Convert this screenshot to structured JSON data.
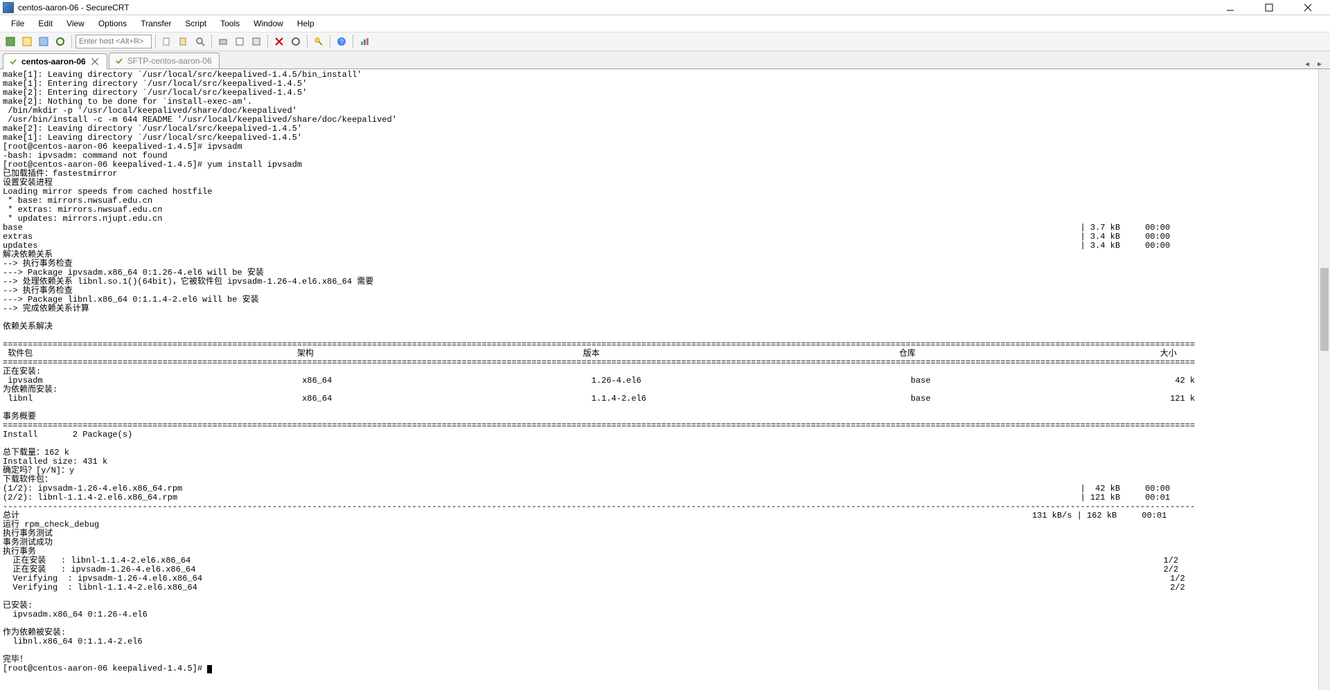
{
  "window": {
    "title": "centos-aaron-06 - SecureCRT"
  },
  "menu": [
    "File",
    "Edit",
    "View",
    "Options",
    "Transfer",
    "Script",
    "Tools",
    "Window",
    "Help"
  ],
  "toolbar": {
    "host_placeholder": "Enter host <Alt+R>"
  },
  "tabs": [
    {
      "label": "centos-aaron-06",
      "active": true,
      "closable": true
    },
    {
      "label": "SFTP-centos-aaron-06",
      "active": false,
      "closable": false
    }
  ],
  "terminal_lines": [
    "make[1]: Leaving directory `/usr/local/src/keepalived-1.4.5/bin_install'",
    "make[1]: Entering directory `/usr/local/src/keepalived-1.4.5'",
    "make[2]: Entering directory `/usr/local/src/keepalived-1.4.5'",
    "make[2]: Nothing to be done for `install-exec-am'.",
    " /bin/mkdir -p '/usr/local/keepalived/share/doc/keepalived'",
    " /usr/bin/install -c -m 644 README '/usr/local/keepalived/share/doc/keepalived'",
    "make[2]: Leaving directory `/usr/local/src/keepalived-1.4.5'",
    "make[1]: Leaving directory `/usr/local/src/keepalived-1.4.5'",
    "[root@centos-aaron-06 keepalived-1.4.5]# ipvsadm",
    "-bash: ipvsadm: command not found",
    "[root@centos-aaron-06 keepalived-1.4.5]# yum install ipvsadm",
    "已加载插件：fastestmirror",
    "设置安装进程",
    "Loading mirror speeds from cached hostfile",
    " * base: mirrors.nwsuaf.edu.cn",
    " * extras: mirrors.nwsuaf.edu.cn",
    " * updates: mirrors.njupt.edu.cn",
    "base                                                                                                                                                                                                                    | 3.7 kB     00:00",
    "extras                                                                                                                                                                                                                  | 3.4 kB     00:00",
    "updates                                                                                                                                                                                                                 | 3.4 kB     00:00",
    "解决依赖关系",
    "--> 执行事务检查",
    "---> Package ipvsadm.x86_64 0:1.26-4.el6 will be 安装",
    "--> 处理依赖关系 libnl.so.1()(64bit)，它被软件包 ipvsadm-1.26-4.el6.x86_64 需要",
    "--> 执行事务检查",
    "---> Package libnl.x86_64 0:1.1.4-2.el6 will be 安装",
    "--> 完成依赖关系计算",
    "",
    "依赖关系解决",
    "",
    "===============================================================================================================================================================================================================================================",
    " 软件包                                                     架构                                                      版本                                                            仓库                                                 大小",
    "===============================================================================================================================================================================================================================================",
    "正在安装:",
    " ipvsadm                                                    x86_64                                                    1.26-4.el6                                                      base                                                 42 k",
    "为依赖而安装:",
    " libnl                                                      x86_64                                                    1.1.4-2.el6                                                     base                                                121 k",
    "",
    "事务概要",
    "===============================================================================================================================================================================================================================================",
    "Install       2 Package(s)",
    "",
    "总下载量：162 k",
    "Installed size: 431 k",
    "确定吗？[y/N]：y",
    "下载软件包：",
    "(1/2): ipvsadm-1.26-4.el6.x86_64.rpm                                                                                                                                                                                    |  42 kB     00:00",
    "(2/2): libnl-1.1.4-2.el6.x86_64.rpm                                                                                                                                                                                     | 121 kB     00:01",
    "-----------------------------------------------------------------------------------------------------------------------------------------------------------------------------------------------------------------------------------------------",
    "总计                                                                                                                                                                                                           131 kB/s | 162 kB     00:01",
    "运行 rpm_check_debug",
    "执行事务测试",
    "事务测试成功",
    "执行事务",
    "  正在安装   : libnl-1.1.4-2.el6.x86_64                                                                                                                                                                                                   1/2",
    "  正在安装   : ipvsadm-1.26-4.el6.x86_64                                                                                                                                                                                                  2/2",
    "  Verifying  : ipvsadm-1.26-4.el6.x86_64                                                                                                                                                                                                  1/2",
    "  Verifying  : libnl-1.1.4-2.el6.x86_64                                                                                                                                                                                                   2/2",
    "",
    "已安装:",
    "  ipvsadm.x86_64 0:1.26-4.el6",
    "",
    "作为依赖被安装:",
    "  libnl.x86_64 0:1.1.4-2.el6",
    "",
    "完毕！",
    "[root@centos-aaron-06 keepalived-1.4.5]# "
  ]
}
